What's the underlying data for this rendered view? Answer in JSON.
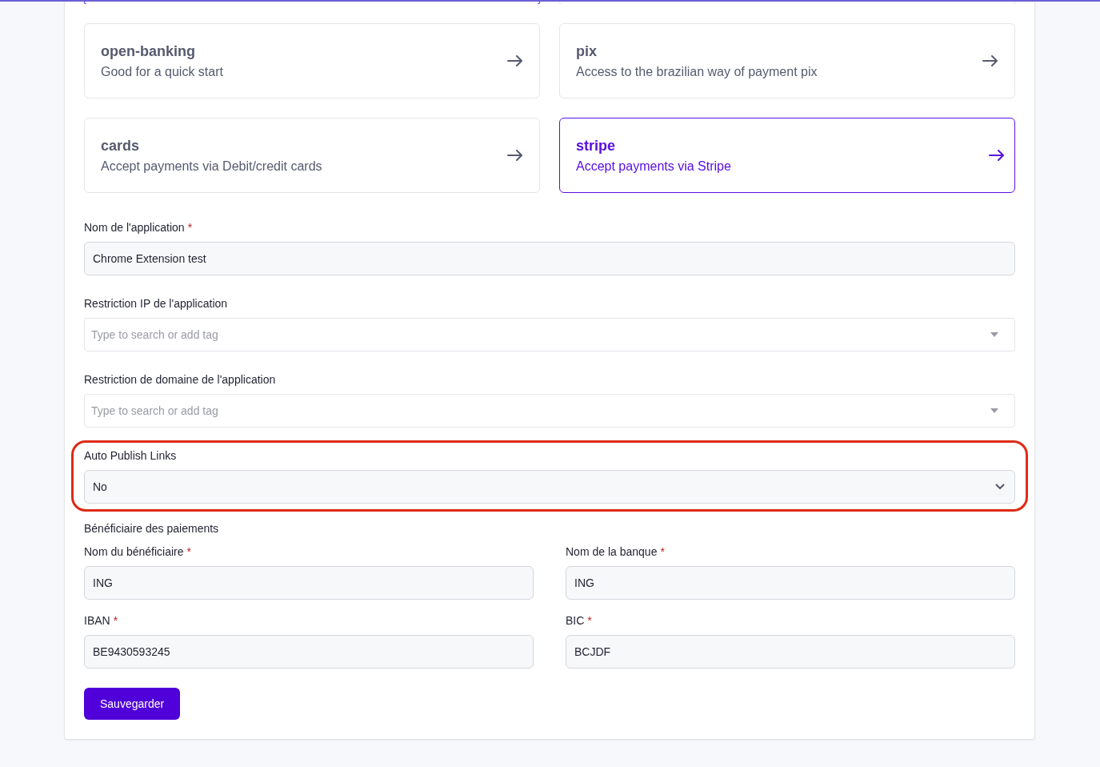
{
  "clipped_cards": [
    {
      "selected": true
    },
    {
      "selected": false
    }
  ],
  "cards": [
    {
      "title": "open-banking",
      "description": "Good for a quick start",
      "selected": false
    },
    {
      "title": "pix",
      "description": "Access to the brazilian way of payment pix",
      "selected": false
    },
    {
      "title": "cards",
      "description": "Accept payments via Debit/credit cards",
      "selected": false
    },
    {
      "title": "stripe",
      "description": "Accept payments via Stripe",
      "selected": true
    }
  ],
  "fields": [
    {
      "kind": "text",
      "label": "Nom de l'application",
      "required_mark": "*",
      "value": "Chrome Extension test"
    },
    {
      "kind": "tags",
      "label": "Restriction IP de l'application",
      "placeholder": "Type to search or add tag"
    },
    {
      "kind": "tags",
      "label": "Restriction de domaine de l'application",
      "placeholder": "Type to search or add tag"
    },
    {
      "kind": "select",
      "label": "Auto Publish Links",
      "value": "No",
      "highlighted": true
    }
  ],
  "beneficiary": {
    "title": "Bénéficiaire des paiements",
    "fields": [
      {
        "label": "Nom du bénéficiaire",
        "required_mark": "*",
        "value": "ING"
      },
      {
        "label": "Nom de la banque",
        "required_mark": "*",
        "value": "ING"
      },
      {
        "label": "IBAN",
        "required_mark": "*",
        "value": "BE9430593245"
      },
      {
        "label": "BIC",
        "required_mark": "*",
        "value": "BCJDF"
      }
    ]
  },
  "save_button": "Sauvegarder"
}
